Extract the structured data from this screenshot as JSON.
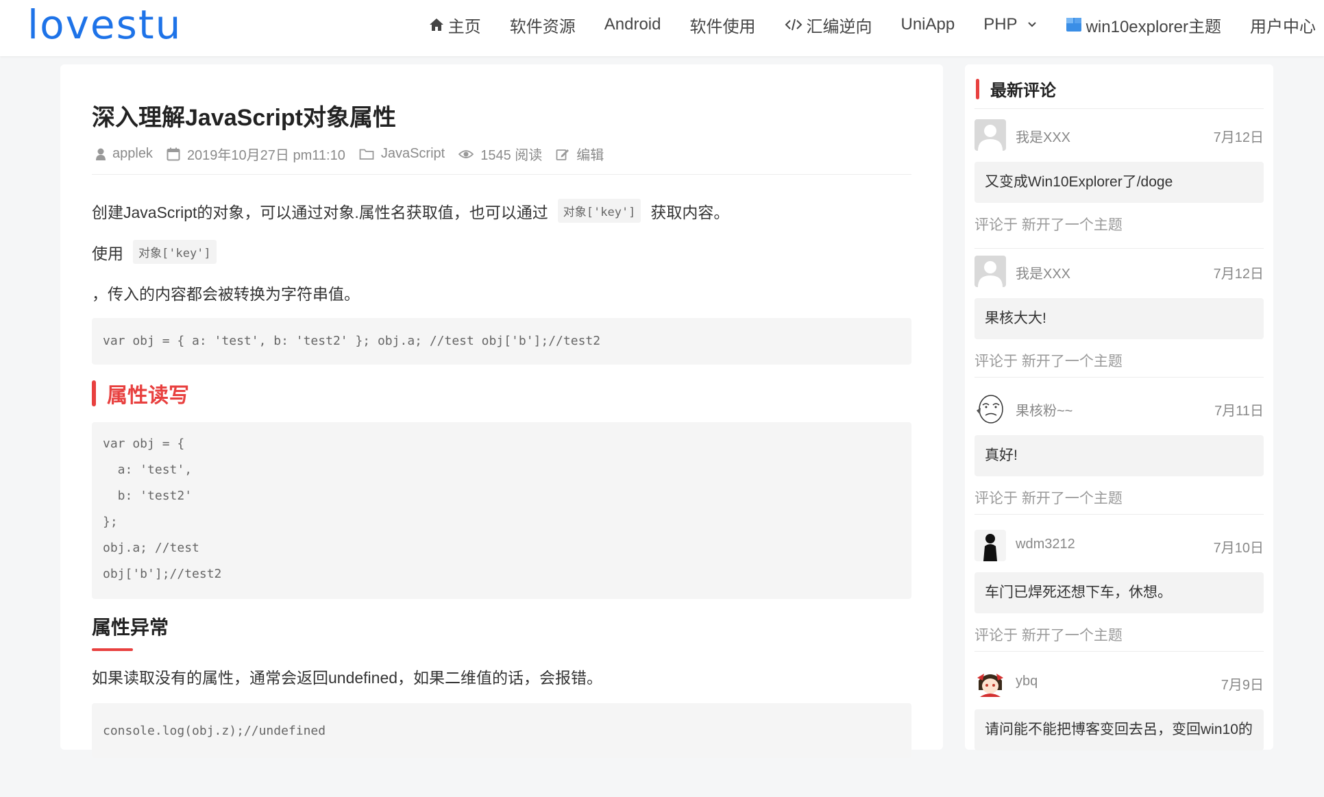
{
  "header": {
    "logo": "lovestu",
    "nav": [
      {
        "label": "主页",
        "icon": "home-icon"
      },
      {
        "label": "软件资源"
      },
      {
        "label": "Android"
      },
      {
        "label": "软件使用"
      },
      {
        "label": "汇编逆向",
        "icon": "code-icon"
      },
      {
        "label": "UniApp"
      },
      {
        "label": "PHP",
        "dropdown": true
      },
      {
        "label": "win10explorer主题",
        "icon": "windows-icon"
      },
      {
        "label": "用户中心"
      }
    ],
    "colors": {
      "brand": "#1e73e8"
    }
  },
  "article": {
    "title": "深入理解JavaScript对象属性",
    "meta": {
      "author": "applek",
      "date": "2019年10月27日 pm11:10",
      "category": "JavaScript",
      "views": "1545 阅读",
      "edit": "编辑"
    },
    "p1_before": "创建JavaScript的对象，可以通过对象.属性名获取值，也可以通过",
    "p1_code": "对象['key']",
    "p1_after": "获取内容。",
    "p2_before": "使用",
    "p2_code": "对象['key']",
    "p3": "，传入的内容都会被转换为字符串值。",
    "code1": "var obj = { a: 'test', b: 'test2' }; obj.a; //test obj['b'];//test2",
    "h2": "属性读写",
    "code2": [
      "var obj = {",
      "  a: 'test',",
      "  b: 'test2'",
      "};",
      "obj.a; //test",
      "obj['b'];//test2"
    ],
    "h3": "属性异常",
    "p4": "如果读取没有的属性，通常会返回undefined，如果二维值的话，会报错。",
    "code3": "console.log(obj.z);//undefined",
    "accent": "#e8403f"
  },
  "sidebar": {
    "title": "最新评论",
    "comments": [
      {
        "name": "我是XXX",
        "date": "7月12日",
        "text": "又变成Win10Explorer了/doge",
        "on": "评论于 新开了一个主题",
        "avatar": "default-avatar-icon"
      },
      {
        "name": "我是XXX",
        "date": "7月12日",
        "text": "果核大大!",
        "on": "评论于 新开了一个主题",
        "avatar": "default-avatar-icon"
      },
      {
        "name": "果核粉~~",
        "date": "7月11日",
        "text": "真好!",
        "on": "评论于 新开了一个主题",
        "avatar": "meme-face-avatar-icon"
      },
      {
        "name": "wdm3212",
        "date": "7月10日",
        "text": "车门已焊死还想下车，休想。",
        "on": "评论于 新开了一个主题",
        "avatar": "silhouette-avatar-icon"
      },
      {
        "name": "ybq",
        "date": "7月9日",
        "text": "请问能不能把博客变回去呂，变回win10的",
        "on": "",
        "avatar": "anime-avatar-icon"
      }
    ]
  }
}
